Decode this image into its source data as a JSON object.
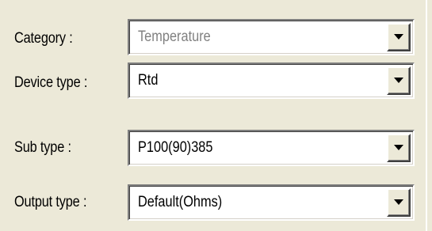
{
  "form": {
    "rows": [
      {
        "label": "Category :",
        "value": "Temperature",
        "state": "disabled"
      },
      {
        "label": "Device type :",
        "value": "Rtd",
        "state": "enabled"
      },
      {
        "label": "Sub type :",
        "value": "P100(90)385",
        "state": "enabled"
      },
      {
        "label": "Output type :",
        "value": "Default(Ohms)",
        "state": "enabled"
      }
    ],
    "dropdown_icon": "chevron-down-icon"
  },
  "colors": {
    "background": "#ece9d8",
    "field_background": "#ffffff",
    "disabled_text": "#808080",
    "text": "#000000"
  }
}
